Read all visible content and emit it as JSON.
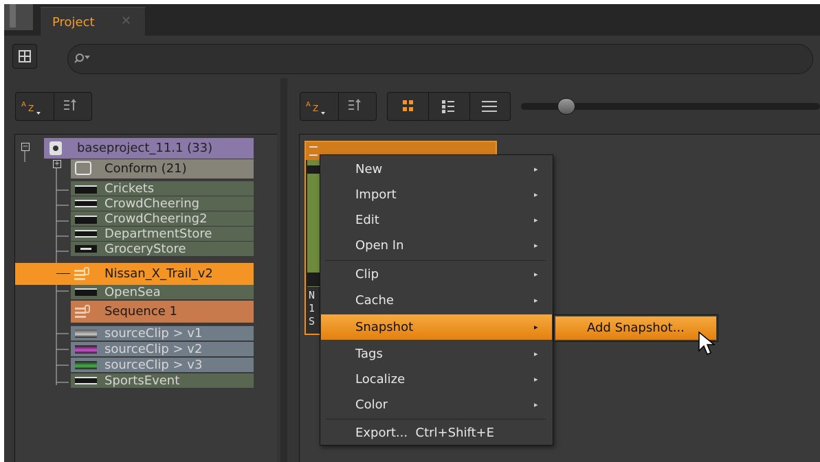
{
  "tab": {
    "title": "Project",
    "close": "✕"
  },
  "toolbar": {
    "layout_icon": "layout-grid-icon",
    "search_icon": "search-icon",
    "search_placeholder": ""
  },
  "left": {
    "sort_az": "A Z",
    "sort_order_icon": "sort-order-icon"
  },
  "right": {
    "sort_az": "A Z",
    "sort_order_icon": "sort-order-icon",
    "view_modes": [
      "large-thumbnails-icon",
      "small-thumbnails-icon",
      "list-view-icon"
    ],
    "zoom_value": 0.1
  },
  "tree": {
    "root": {
      "label": "baseproject_11.1 (33)",
      "color": "#8a78a8"
    },
    "items": [
      {
        "label": "Conform (21)",
        "type": "folder",
        "color": "#868478"
      },
      {
        "label": "Crickets",
        "type": "audio",
        "color": "#586652"
      },
      {
        "label": "CrowdCheering",
        "type": "audio",
        "color": "#586652"
      },
      {
        "label": "CrowdCheering2",
        "type": "audio",
        "color": "#586652"
      },
      {
        "label": "DepartmentStore",
        "type": "audio",
        "color": "#586652"
      },
      {
        "label": "GroceryStore",
        "type": "audio",
        "color": "#586652"
      },
      {
        "label": "Nissan_X_Trail_v2",
        "type": "sequence",
        "color": "#f39424"
      },
      {
        "label": "OpenSea",
        "type": "audio",
        "color": "#586652"
      },
      {
        "label": "Sequence 1",
        "type": "sequence",
        "color": "#c97a4c"
      },
      {
        "label": "sourceClip > v1",
        "type": "video",
        "color": "#707c88"
      },
      {
        "label": "sourceClip > v2",
        "type": "video",
        "color": "#707c88"
      },
      {
        "label": "sourceClip > v3",
        "type": "video",
        "color": "#707c88"
      },
      {
        "label": "SportsEvent",
        "type": "audio",
        "color": "#586652"
      }
    ]
  },
  "thumbnail": {
    "line1": "N",
    "line2": "1",
    "line3": "S"
  },
  "context_menu": {
    "items": [
      {
        "label": "New",
        "arrow": "▸"
      },
      {
        "label": "Import",
        "arrow": "▸"
      },
      {
        "label": "Edit",
        "arrow": "▸"
      },
      {
        "label": "Open In",
        "arrow": "▸"
      },
      {
        "label": "Clip",
        "arrow": "▸"
      },
      {
        "label": "Cache",
        "arrow": "▸"
      },
      {
        "label": "Snapshot",
        "arrow": "▸"
      },
      {
        "label": "Tags",
        "arrow": "▸"
      },
      {
        "label": "Localize",
        "arrow": "▸"
      },
      {
        "label": "Color",
        "arrow": "▸"
      },
      {
        "label": "Export...  Ctrl+Shift+E",
        "arrow": ""
      }
    ],
    "selected": "Snapshot"
  },
  "submenu": {
    "items": [
      {
        "label": "Add Snapshot..."
      }
    ]
  },
  "colors": {
    "accent": "#f39424",
    "panel_bg": "#353535"
  }
}
